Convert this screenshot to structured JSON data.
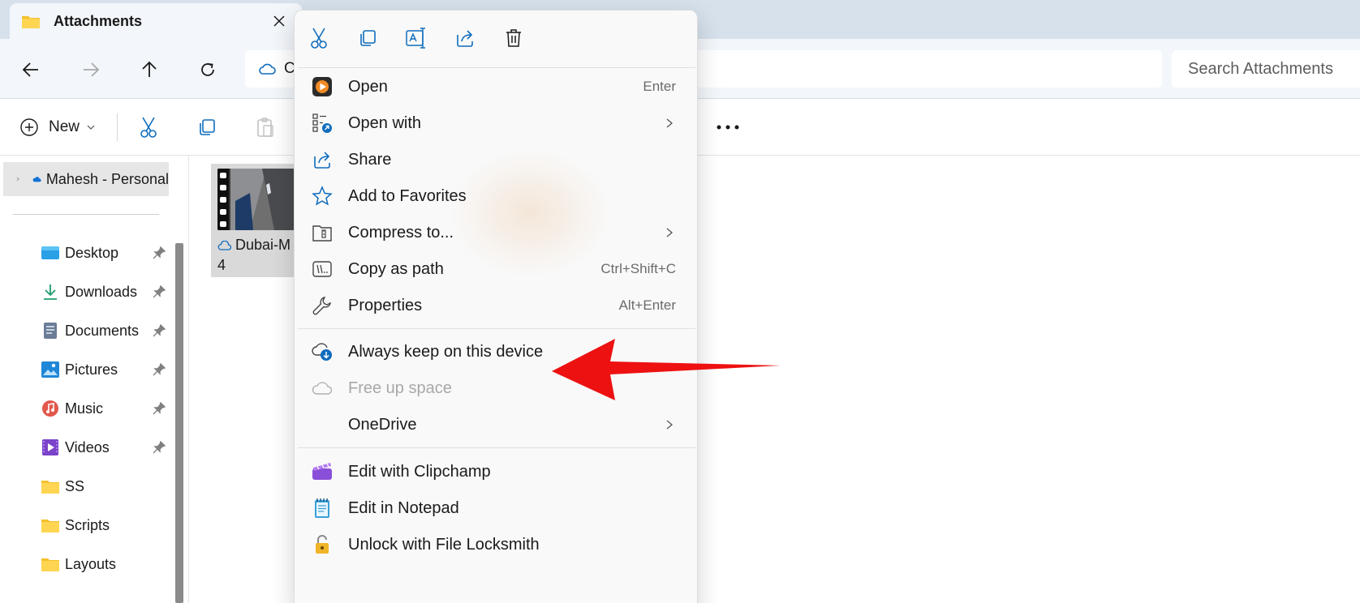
{
  "window": {
    "tab_title": "Attachments"
  },
  "address_bar": {
    "path_text": "C"
  },
  "search": {
    "placeholder": "Search Attachments"
  },
  "command_bar": {
    "new_label": "New"
  },
  "sidebar": {
    "onedrive_label": "Mahesh - Personal",
    "items": [
      {
        "label": "Desktop",
        "icon": "desktop-icon",
        "pinned": true
      },
      {
        "label": "Downloads",
        "icon": "downloads-icon",
        "pinned": true
      },
      {
        "label": "Documents",
        "icon": "documents-icon",
        "pinned": true
      },
      {
        "label": "Pictures",
        "icon": "pictures-icon",
        "pinned": true
      },
      {
        "label": "Music",
        "icon": "music-icon",
        "pinned": true
      },
      {
        "label": "Videos",
        "icon": "videos-icon",
        "pinned": true
      },
      {
        "label": "SS",
        "icon": "folder-icon",
        "pinned": false
      },
      {
        "label": "Scripts",
        "icon": "folder-icon",
        "pinned": false
      },
      {
        "label": "Layouts",
        "icon": "folder-icon",
        "pinned": false
      }
    ]
  },
  "file": {
    "name_line1": "Dubai-M",
    "name_line2": "4"
  },
  "context_menu": {
    "toolbar_icons": [
      "cut-icon",
      "copy-icon",
      "rename-icon",
      "share-icon",
      "delete-icon"
    ],
    "items": [
      {
        "label": "Open",
        "shortcut": "Enter",
        "icon": "media-player-icon",
        "submenu": false
      },
      {
        "label": "Open with",
        "shortcut": "",
        "icon": "open-with-icon",
        "submenu": true
      },
      {
        "label": "Share",
        "shortcut": "",
        "icon": "share-icon",
        "submenu": false
      },
      {
        "label": "Add to Favorites",
        "shortcut": "",
        "icon": "star-icon",
        "submenu": false
      },
      {
        "label": "Compress to...",
        "shortcut": "",
        "icon": "zip-icon",
        "submenu": true
      },
      {
        "label": "Copy as path",
        "shortcut": "Ctrl+Shift+C",
        "icon": "copy-path-icon",
        "submenu": false
      },
      {
        "label": "Properties",
        "shortcut": "Alt+Enter",
        "icon": "wrench-icon",
        "submenu": false
      },
      {
        "label": "Always keep on this device",
        "shortcut": "",
        "icon": "cloud-download-icon",
        "submenu": false
      },
      {
        "label": "Free up space",
        "shortcut": "",
        "icon": "cloud-icon",
        "submenu": false,
        "disabled": true
      },
      {
        "label": "OneDrive",
        "shortcut": "",
        "icon": "",
        "submenu": true
      },
      {
        "label": "Edit with Clipchamp",
        "shortcut": "",
        "icon": "clipchamp-icon",
        "submenu": false
      },
      {
        "label": "Edit in Notepad",
        "shortcut": "",
        "icon": "notepad-icon",
        "submenu": false
      },
      {
        "label": "Unlock with File Locksmith",
        "shortcut": "",
        "icon": "lock-icon",
        "submenu": false
      }
    ]
  },
  "colors": {
    "accent": "#0f6cbd",
    "annotation_arrow": "#ee1111",
    "titlebar": "#d6e1ec",
    "menu_bg": "#f9f9f9"
  }
}
